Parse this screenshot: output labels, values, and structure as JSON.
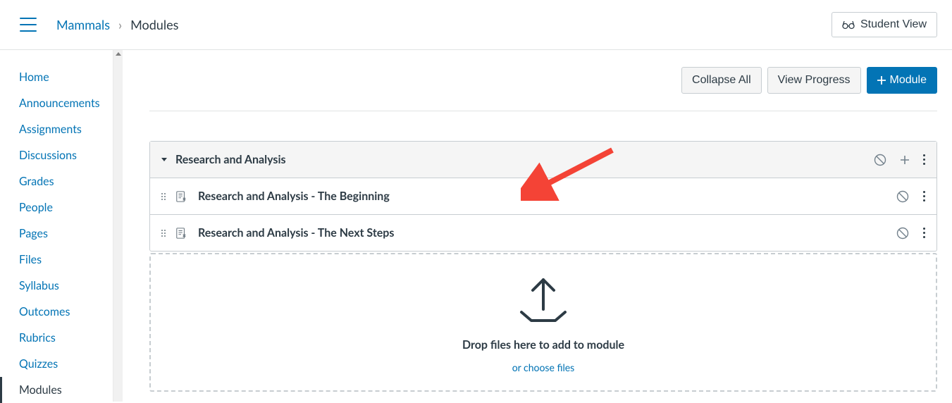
{
  "breadcrumb": {
    "course": "Mammals",
    "page": "Modules"
  },
  "topbar": {
    "student_view_label": "Student View"
  },
  "sidebar": {
    "items": [
      "Home",
      "Announcements",
      "Assignments",
      "Discussions",
      "Grades",
      "People",
      "Pages",
      "Files",
      "Syllabus",
      "Outcomes",
      "Rubrics",
      "Quizzes",
      "Modules"
    ],
    "active_index": 12
  },
  "actions": {
    "collapse_all": "Collapse All",
    "view_progress": "View Progress",
    "add_module": "Module"
  },
  "module": {
    "title": "Research and Analysis",
    "items": [
      {
        "title": "Research and Analysis - The Beginning"
      },
      {
        "title": "Research and Analysis - The Next Steps"
      }
    ]
  },
  "dropzone": {
    "instruction": "Drop files here to add to module",
    "choose": "or choose files"
  }
}
